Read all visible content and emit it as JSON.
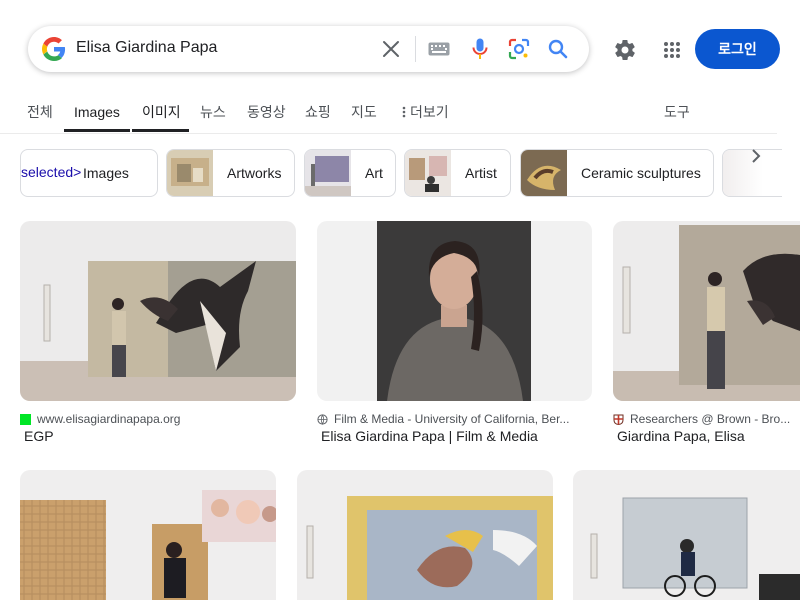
{
  "search": {
    "query": "Elisa Giardina Papa",
    "icons": [
      "google-g-icon",
      "clear-icon",
      "keyboard-icon",
      "mic-icon",
      "lens-icon",
      "search-icon"
    ]
  },
  "header": {
    "login_label": "로그인",
    "icons": [
      "settings-icon",
      "apps-icon"
    ],
    "accent_color": "#0b57d0"
  },
  "tabs": [
    {
      "label": "전체",
      "active": false
    },
    {
      "label": "Images",
      "active": true
    },
    {
      "label": "이미지",
      "active": true
    },
    {
      "label": "뉴스",
      "active": false
    },
    {
      "label": "동영상",
      "active": false
    },
    {
      "label": "쇼핑",
      "active": false
    },
    {
      "label": "지도",
      "active": false
    },
    {
      "label": "더보기",
      "active": false
    }
  ],
  "tools_label": "도구",
  "more_icon": "more-vert-icon",
  "chips": [
    {
      "prefix": "selected>",
      "label": "Images"
    },
    {
      "label": "Artworks"
    },
    {
      "label": "Art"
    },
    {
      "label": "Artist"
    },
    {
      "label": "Ceramic sculptures"
    }
  ],
  "chip_next_icon": "chevron-right-icon",
  "results": [
    {
      "source": "www.elisagiardinapapa.org",
      "title": "EGP",
      "favicon": "green-square-icon"
    },
    {
      "source": "Film & Media - University of California, Ber...",
      "title": "Elisa Giardina Papa | Film & Media",
      "favicon": "globe-icon"
    },
    {
      "source": "Researchers @ Brown - Bro...",
      "title": "Giardina Papa, Elisa",
      "favicon": "brown-shield-icon"
    }
  ]
}
